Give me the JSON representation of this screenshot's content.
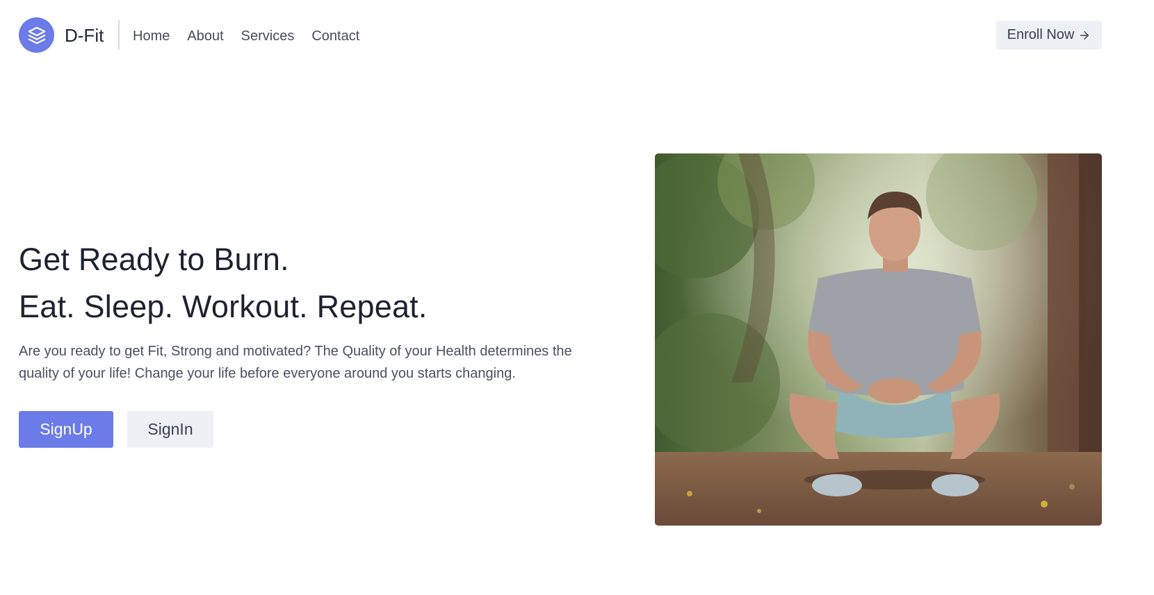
{
  "header": {
    "brand": "D-Fit",
    "nav": [
      "Home",
      "About",
      "Services",
      "Contact"
    ],
    "enroll_label": "Enroll Now",
    "accent_color": "#6b7be8"
  },
  "hero": {
    "title_line1": "Get Ready to Burn.",
    "title_line2": "Eat. Sleep. Workout. Repeat.",
    "description_line1": "Are you ready to get Fit, Strong and motivated? The Quality of your Health determines the",
    "description_line2": "quality of your life! Change your life before everyone around you starts changing.",
    "signup_label": "SignUp",
    "signin_label": "SignIn"
  },
  "icons": {
    "logo": "layers-icon",
    "enroll_arrow": "arrow-right-icon"
  }
}
